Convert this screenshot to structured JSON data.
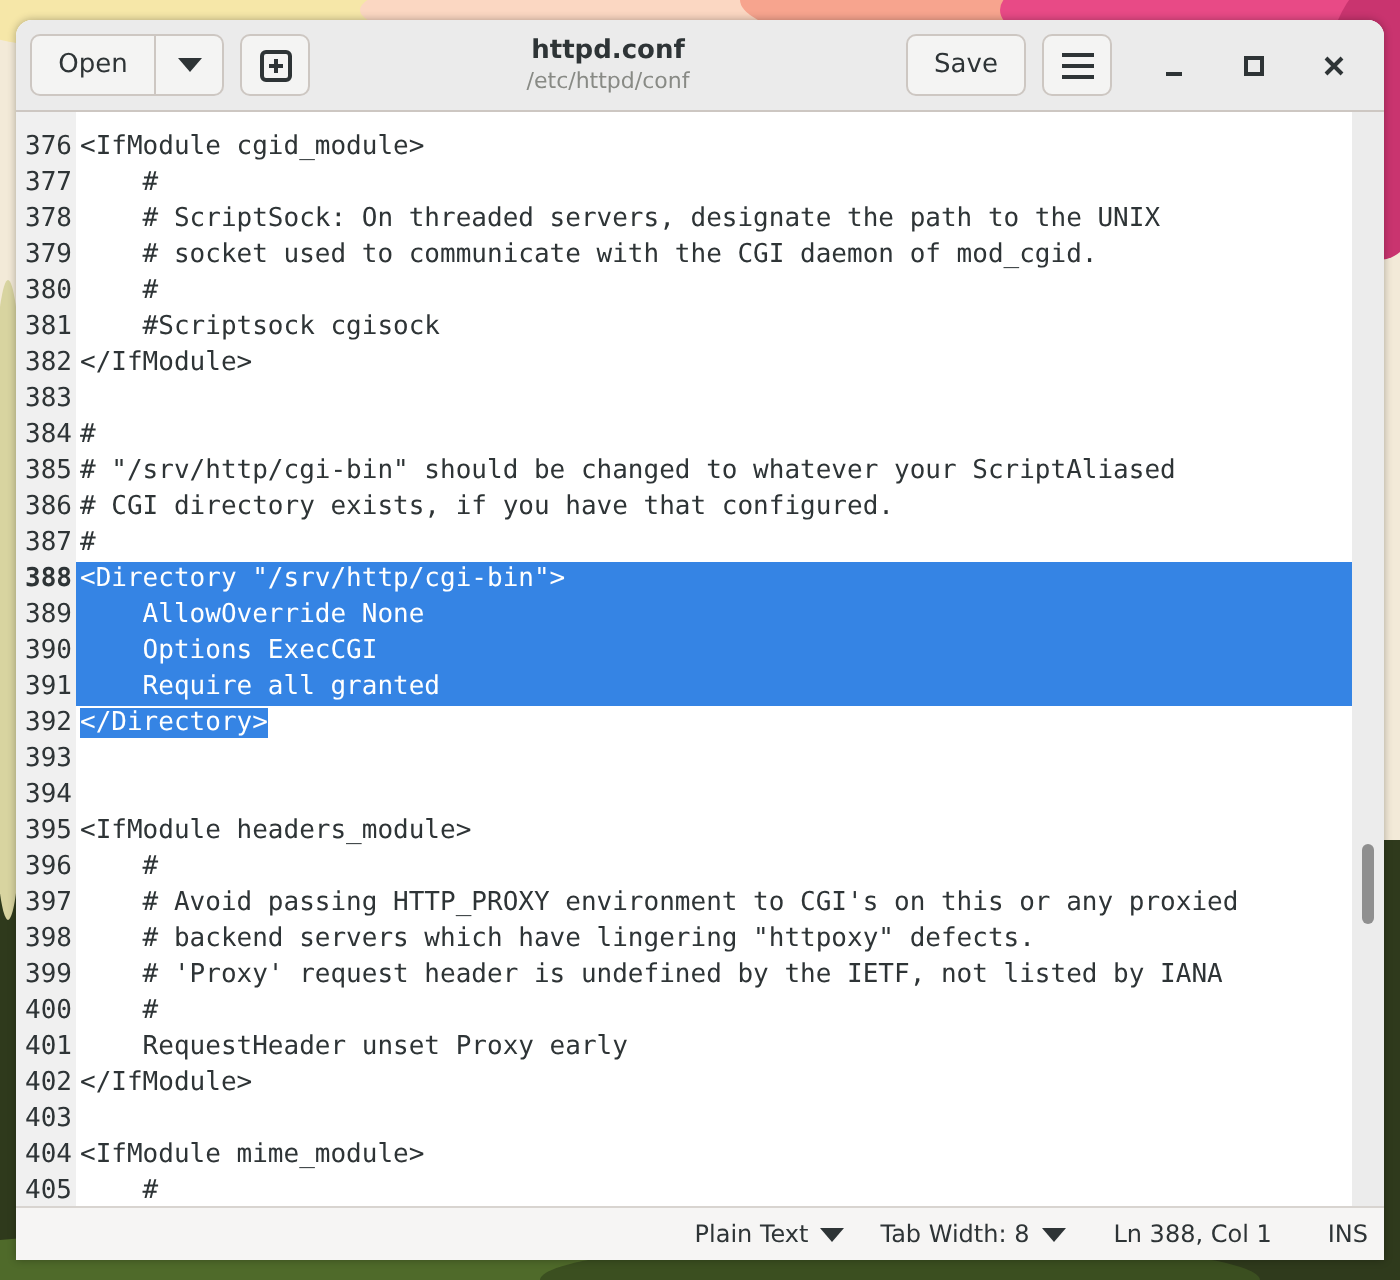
{
  "window": {
    "title": "httpd.conf",
    "subtitle": "/etc/httpd/conf"
  },
  "header_buttons": {
    "open": "Open",
    "save": "Save"
  },
  "editor": {
    "lines": [
      {
        "number": "376",
        "text": "<IfModule cgid_module>",
        "selected": false,
        "current": false
      },
      {
        "number": "377",
        "text": "    #",
        "selected": false,
        "current": false
      },
      {
        "number": "378",
        "text": "    # ScriptSock: On threaded servers, designate the path to the UNIX",
        "selected": false,
        "current": false
      },
      {
        "number": "379",
        "text": "    # socket used to communicate with the CGI daemon of mod_cgid.",
        "selected": false,
        "current": false
      },
      {
        "number": "380",
        "text": "    #",
        "selected": false,
        "current": false
      },
      {
        "number": "381",
        "text": "    #Scriptsock cgisock",
        "selected": false,
        "current": false
      },
      {
        "number": "382",
        "text": "</IfModule>",
        "selected": false,
        "current": false
      },
      {
        "number": "383",
        "selected": false,
        "current": false
      },
      {
        "number": "384",
        "text": "#",
        "selected": false,
        "current": false
      },
      {
        "number": "385",
        "text": "# \"/srv/http/cgi-bin\" should be changed to whatever your ScriptAliased",
        "selected": false,
        "current": false
      },
      {
        "number": "386",
        "text": "# CGI directory exists, if you have that configured.",
        "selected": false,
        "current": false
      },
      {
        "number": "387",
        "text": "#",
        "selected": false,
        "current": false
      },
      {
        "number": "388",
        "text": "<Directory \"/srv/http/cgi-bin\">",
        "selected": true,
        "current": true
      },
      {
        "number": "389",
        "text": "    AllowOverride None",
        "selected": true,
        "current": false
      },
      {
        "number": "390",
        "text": "    Options ExecCGI",
        "selected": true,
        "current": false
      },
      {
        "number": "391",
        "text": "    Require all granted",
        "selected": true,
        "current": false
      },
      {
        "number": "392",
        "text": "</Directory>",
        "selected": true,
        "current": false
      },
      {
        "number": "393",
        "selected": false,
        "current": false
      },
      {
        "number": "394",
        "selected": false,
        "current": false
      },
      {
        "number": "395",
        "text": "<IfModule headers_module>",
        "selected": false,
        "current": false
      },
      {
        "number": "396",
        "text": "    #",
        "selected": false,
        "current": false
      },
      {
        "number": "397",
        "text": "    # Avoid passing HTTP_PROXY environment to CGI's on this or any proxied",
        "selected": false,
        "current": false
      },
      {
        "number": "398",
        "text": "    # backend servers which have lingering \"httpoxy\" defects.",
        "selected": false,
        "current": false
      },
      {
        "number": "399",
        "text": "    # 'Proxy' request header is undefined by the IETF, not listed by IANA",
        "selected": false,
        "current": false
      },
      {
        "number": "400",
        "text": "    #",
        "selected": false,
        "current": false
      },
      {
        "number": "401",
        "text": "    RequestHeader unset Proxy early",
        "selected": false,
        "current": false
      },
      {
        "number": "402",
        "text": "</IfModule>",
        "selected": false,
        "current": false
      },
      {
        "number": "403",
        "selected": false,
        "current": false
      },
      {
        "number": "404",
        "text": "<IfModule mime_module>",
        "selected": false,
        "current": false
      },
      {
        "number": "405",
        "text": "    #",
        "selected": false,
        "current": false
      }
    ]
  },
  "status_bar": {
    "language": "Plain Text",
    "tab_width": "Tab Width: 8",
    "position": "Ln 388, Col 1",
    "mode": "INS"
  }
}
